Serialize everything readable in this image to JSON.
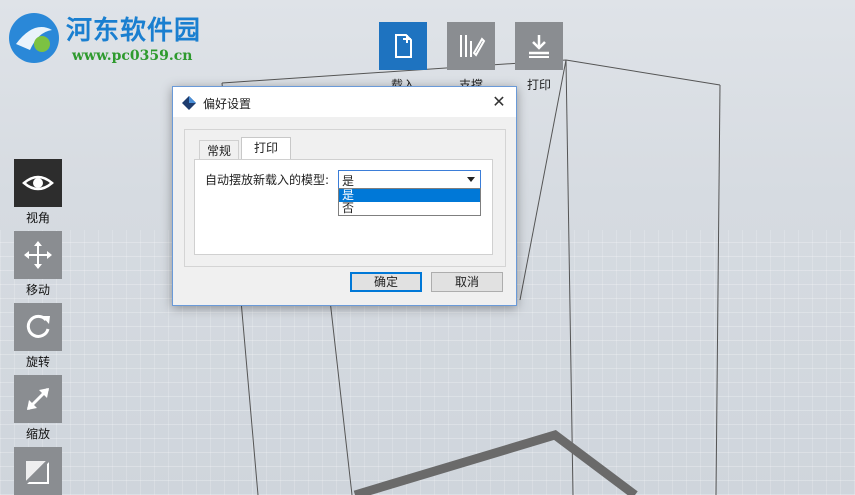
{
  "watermark": {
    "title": "河东软件园",
    "url": "www.pc0359.cn"
  },
  "top_toolbar": [
    {
      "label": "载入",
      "icon": "load-file-icon"
    },
    {
      "label": "支撑",
      "icon": "support-icon"
    },
    {
      "label": "打印",
      "icon": "print-icon"
    }
  ],
  "left_toolbar": [
    {
      "label": "视角",
      "icon": "eye-icon"
    },
    {
      "label": "移动",
      "icon": "move-icon"
    },
    {
      "label": "旋转",
      "icon": "rotate-icon"
    },
    {
      "label": "缩放",
      "icon": "scale-icon"
    },
    {
      "label": "",
      "icon": "mirror-icon"
    }
  ],
  "dialog": {
    "title": "偏好设置",
    "tabs": [
      "常规",
      "打印"
    ],
    "active_tab": "打印",
    "option_label": "自动摆放新载入的模型:",
    "select_value": "是",
    "options": [
      "是",
      "否"
    ],
    "ok_label": "确定",
    "cancel_label": "取消"
  },
  "colors": {
    "accent": "#1e73c0",
    "arrow": "#d42020",
    "selection": "#0078d7"
  }
}
